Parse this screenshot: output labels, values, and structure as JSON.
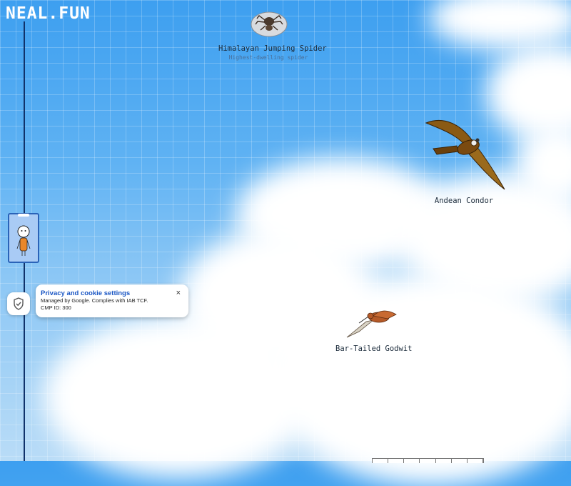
{
  "logo": "NEAL.FUN",
  "animals": [
    {
      "name": "Himalayan Jumping Spider",
      "subtitle": "Highest-dwelling spider",
      "icon": "spider-icon"
    },
    {
      "name": "Andean Condor",
      "icon": "condor-icon"
    },
    {
      "name": "Bar-Tailed Godwit",
      "icon": "godwit-icon"
    }
  ],
  "consent": {
    "title": "Privacy and cookie settings",
    "line1": "Managed by Google. Complies with IAB TCF.",
    "line2": "CMP ID: 300",
    "close": "×"
  },
  "colors": {
    "sky": "#3d9ff0",
    "link": "#1a56c4",
    "rail": "#10326a",
    "elevator": "#a9cbf5"
  }
}
